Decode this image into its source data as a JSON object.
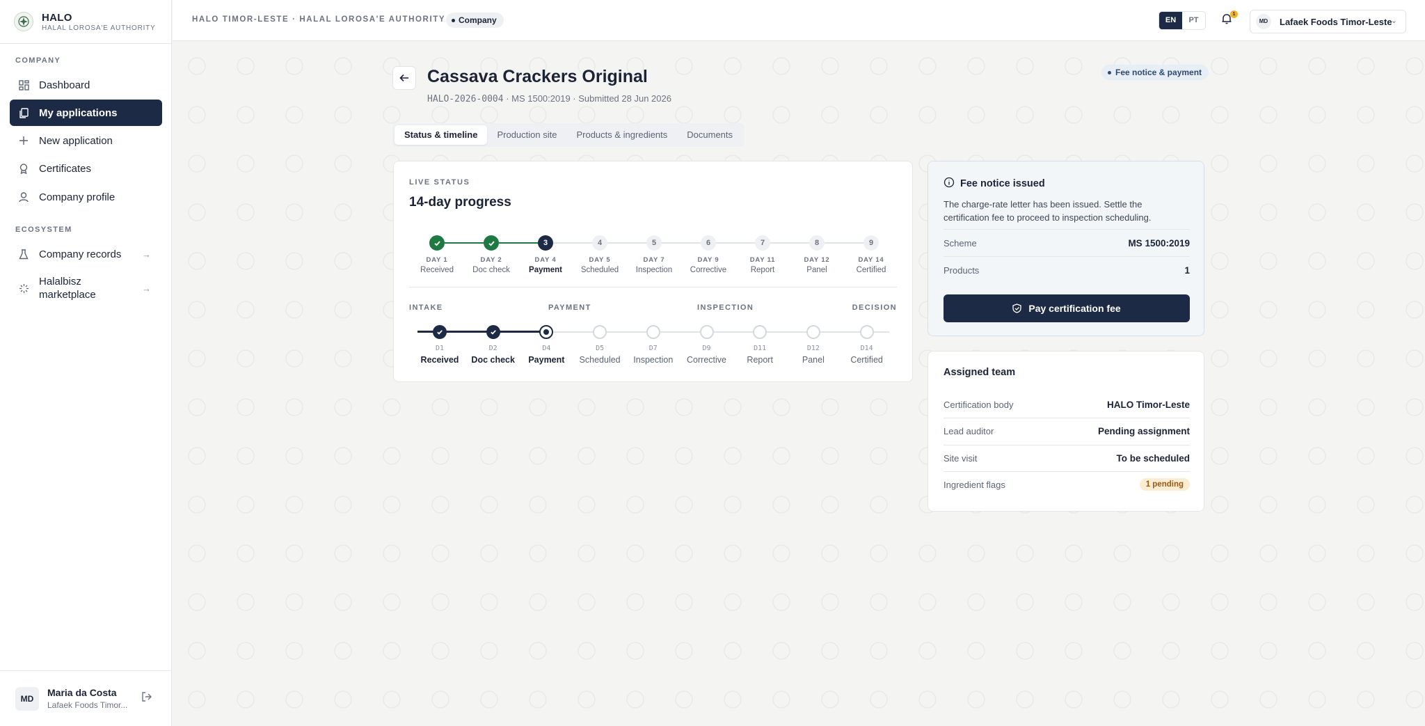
{
  "brand": {
    "name": "HALO",
    "subtitle": "HALAL LOROSA'E AUTHORITY"
  },
  "sidebar": {
    "sections": [
      "COMPANY",
      "ECOSYSTEM"
    ],
    "items": [
      {
        "label": "Dashboard",
        "icon": "dashboard-icon"
      },
      {
        "label": "My applications",
        "icon": "applications-icon",
        "active": true
      },
      {
        "label": "New application",
        "icon": "plus-icon"
      },
      {
        "label": "Certificates",
        "icon": "award-icon"
      },
      {
        "label": "Company profile",
        "icon": "user-icon"
      }
    ],
    "ecosystem": [
      {
        "label": "Company records",
        "icon": "flask-icon"
      },
      {
        "label": "Halalbisz marketplace",
        "icon": "spark-icon"
      }
    ],
    "user": {
      "initials": "MD",
      "name": "Maria da Costa",
      "org": "Lafaek Foods Timor..."
    }
  },
  "topbar": {
    "breadcrumb": "HALO TIMOR-LESTE · HALAL LOROSA'E AUTHORITY",
    "role": "Company",
    "languages": [
      "EN",
      "PT"
    ],
    "active_language": "EN",
    "notifications": "1",
    "org_initials": "MD",
    "org_name": "Lafaek Foods Timor-Leste"
  },
  "page": {
    "title": "Cassava Crackers Original",
    "meta_ref": "HALO-2026-0004",
    "meta_rest": " · MS 1500:2019 · Submitted 28 Jun 2026",
    "stage": "Fee notice & payment",
    "tabs": [
      "Status & timeline",
      "Production site",
      "Products & ingredients",
      "Documents"
    ]
  },
  "progress": {
    "eyebrow": "LIVE STATUS",
    "title": "14-day progress",
    "steps": [
      {
        "n": "1",
        "day": "DAY 1",
        "label": "Received",
        "state": "done"
      },
      {
        "n": "2",
        "day": "DAY 2",
        "label": "Doc check",
        "state": "done"
      },
      {
        "n": "3",
        "day": "DAY 4",
        "label": "Payment",
        "state": "current"
      },
      {
        "n": "4",
        "day": "DAY 5",
        "label": "Scheduled",
        "state": "todo"
      },
      {
        "n": "5",
        "day": "DAY 7",
        "label": "Inspection",
        "state": "todo"
      },
      {
        "n": "6",
        "day": "DAY 9",
        "label": "Corrective",
        "state": "todo"
      },
      {
        "n": "7",
        "day": "DAY 11",
        "label": "Report",
        "state": "todo"
      },
      {
        "n": "8",
        "day": "DAY 12",
        "label": "Panel",
        "state": "todo"
      },
      {
        "n": "9",
        "day": "DAY 14",
        "label": "Certified",
        "state": "todo"
      }
    ],
    "phases": [
      "INTAKE",
      "PAYMENT",
      "INSPECTION",
      "DECISION"
    ],
    "timeline": [
      {
        "day": "D1",
        "label": "Received",
        "state": "done"
      },
      {
        "day": "D2",
        "label": "Doc check",
        "state": "done"
      },
      {
        "day": "D4",
        "label": "Payment",
        "state": "current"
      },
      {
        "day": "D5",
        "label": "Scheduled",
        "state": "todo"
      },
      {
        "day": "D7",
        "label": "Inspection",
        "state": "todo"
      },
      {
        "day": "D9",
        "label": "Corrective",
        "state": "todo"
      },
      {
        "day": "D11",
        "label": "Report",
        "state": "todo"
      },
      {
        "day": "D12",
        "label": "Panel",
        "state": "todo"
      },
      {
        "day": "D14",
        "label": "Certified",
        "state": "todo"
      }
    ]
  },
  "fee": {
    "title": "Fee notice issued",
    "text": "The charge-rate letter has been issued. Settle the certification fee to proceed to inspection scheduling.",
    "rows": [
      {
        "k": "Scheme",
        "v": "MS 1500:2019"
      },
      {
        "k": "Products",
        "v": "1"
      }
    ],
    "button": "Pay certification fee"
  },
  "team": {
    "title": "Assigned team",
    "rows": [
      {
        "k": "Certification body",
        "v": "HALO Timor-Leste"
      },
      {
        "k": "Lead auditor",
        "v": "Pending assignment"
      },
      {
        "k": "Site visit",
        "v": "To be scheduled"
      },
      {
        "k": "Ingredient flags",
        "v": "1 pending"
      }
    ]
  },
  "colors": {
    "navy": "#1c2a45",
    "done_green": "#1e7a42",
    "warning": "#f0b429"
  }
}
